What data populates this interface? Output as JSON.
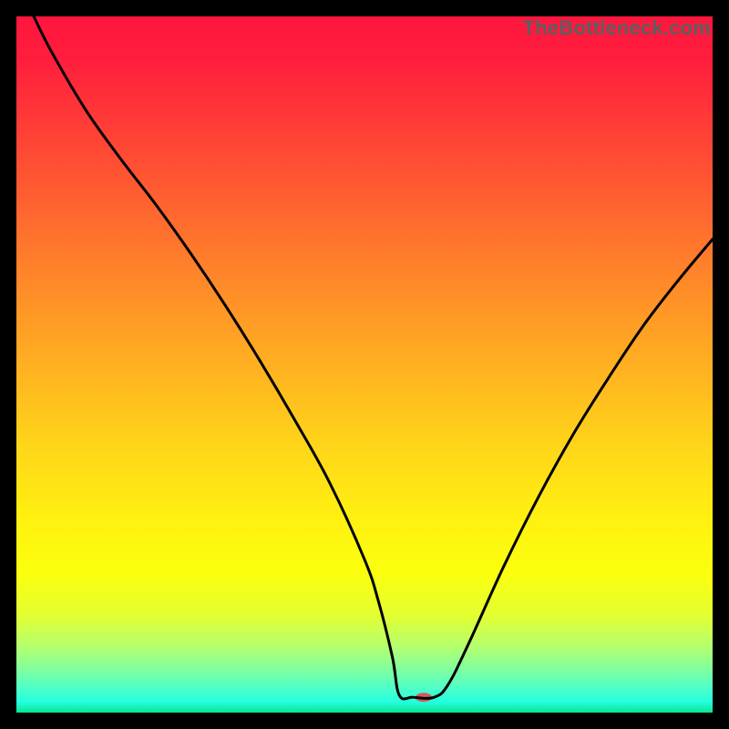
{
  "watermark": "TheBottleneck.com",
  "chart_data": {
    "type": "line",
    "title": "",
    "xlabel": "",
    "ylabel": "",
    "xlim": [
      0,
      100
    ],
    "ylim": [
      0,
      100
    ],
    "grid": false,
    "legend": false,
    "gradient_stops": [
      {
        "offset": 0.0,
        "color": "#ff163e"
      },
      {
        "offset": 0.06,
        "color": "#ff1d3d"
      },
      {
        "offset": 0.2,
        "color": "#ff4b34"
      },
      {
        "offset": 0.35,
        "color": "#ff7e2b"
      },
      {
        "offset": 0.5,
        "color": "#ffb021"
      },
      {
        "offset": 0.62,
        "color": "#ffd619"
      },
      {
        "offset": 0.72,
        "color": "#fff010"
      },
      {
        "offset": 0.8,
        "color": "#fbff0e"
      },
      {
        "offset": 0.86,
        "color": "#e3ff31"
      },
      {
        "offset": 0.905,
        "color": "#b4ff6e"
      },
      {
        "offset": 0.94,
        "color": "#7dffa1"
      },
      {
        "offset": 0.965,
        "color": "#4effc9"
      },
      {
        "offset": 0.985,
        "color": "#23ffde"
      },
      {
        "offset": 1.0,
        "color": "#07e591"
      }
    ],
    "series": [
      {
        "name": "bottleneck-curve",
        "color": "#000000",
        "x": [
          2.5,
          5,
          10,
          15,
          20,
          25,
          30,
          35,
          40,
          45,
          50,
          52,
          54,
          55,
          57,
          60,
          62,
          65,
          70,
          75,
          80,
          85,
          90,
          95,
          100
        ],
        "y": [
          100,
          95,
          86.5,
          79.5,
          73,
          66,
          58.5,
          50.5,
          42,
          33,
          22,
          16,
          8,
          2.5,
          2.2,
          2.2,
          4,
          10,
          21,
          31,
          40,
          48,
          55.5,
          62,
          68
        ]
      }
    ],
    "marker": {
      "x": 58.5,
      "y": 2.2,
      "color": "#d7575e",
      "rx": 9,
      "ry": 5
    }
  }
}
